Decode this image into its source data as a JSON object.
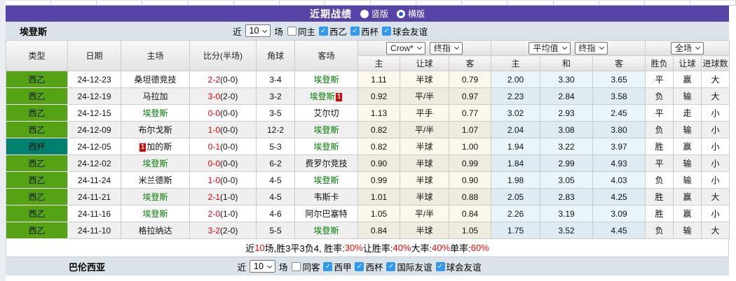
{
  "colors": {
    "accent_purple": "#5843a6",
    "league_green": "#55a315",
    "cup_teal": "#00806e",
    "focal_team_green": "#008000",
    "score_red": "#e00000",
    "result_blue": "#0000cd",
    "checkbox_blue": "#2f99f1"
  },
  "title_bar": {
    "title": "近期战绩",
    "radios": [
      {
        "label": "竖版",
        "selected": false
      },
      {
        "label": "横版",
        "selected": true
      }
    ]
  },
  "team_filter": {
    "team": "埃登斯",
    "near_label": "近",
    "count_select": "10",
    "unit_label": "场",
    "checkboxes": [
      {
        "label": "同主",
        "checked": false
      },
      {
        "label": "西乙",
        "checked": true
      },
      {
        "label": "西杯",
        "checked": true
      },
      {
        "label": "球会友谊",
        "checked": true
      }
    ]
  },
  "table": {
    "dropdowns": {
      "odds_source": "Crow*",
      "odds_stage": "终指",
      "avg_source": "平均值",
      "avg_stage": "终指",
      "scope": "全场"
    },
    "columns": {
      "type": "类型",
      "date": "日期",
      "home": "主场",
      "score": "比分(半场)",
      "corner": "角球",
      "away": "客场",
      "odds_home": "主",
      "odds_handicap": "让球",
      "odds_away": "客",
      "avg_home": "主",
      "avg_draw": "和",
      "avg_away": "客",
      "result_wdl": "胜负",
      "result_handicap": "让球",
      "result_goals": "进球数"
    },
    "rows": [
      {
        "type": "西乙",
        "type_color": "green",
        "date": "24-12-23",
        "home": {
          "name": "桑坦德竞技",
          "focal": false,
          "badge": "",
          "badge_side": ""
        },
        "score": "2-2",
        "half": "(0-0)",
        "corner": "3-4",
        "away": {
          "name": "埃登斯",
          "focal": true,
          "badge": "",
          "badge_side": ""
        },
        "odds": [
          "1.11",
          "半球",
          "0.79"
        ],
        "avg": [
          "2.00",
          "3.30",
          "3.65"
        ],
        "results": [
          "平",
          "赢",
          "大"
        ]
      },
      {
        "type": "西乙",
        "type_color": "green",
        "date": "24-12-19",
        "home": {
          "name": "马拉加",
          "focal": false,
          "badge": "",
          "badge_side": ""
        },
        "score": "3-0",
        "half": "(2-0)",
        "corner": "3-2",
        "away": {
          "name": "埃登斯",
          "focal": true,
          "badge": "1",
          "badge_side": "after"
        },
        "odds": [
          "0.92",
          "平/半",
          "0.97"
        ],
        "avg": [
          "2.23",
          "2.84",
          "3.58"
        ],
        "results": [
          "负",
          "输",
          "大"
        ]
      },
      {
        "type": "西乙",
        "type_color": "green",
        "date": "24-12-15",
        "home": {
          "name": "埃登斯",
          "focal": true,
          "badge": "",
          "badge_side": ""
        },
        "score": "0-0",
        "half": "(0-0)",
        "corner": "3-5",
        "away": {
          "name": "艾尔切",
          "focal": false,
          "badge": "",
          "badge_side": ""
        },
        "odds": [
          "1.13",
          "平手",
          "0.77"
        ],
        "avg": [
          "3.02",
          "2.93",
          "2.45"
        ],
        "results": [
          "平",
          "走",
          "小"
        ]
      },
      {
        "type": "西乙",
        "type_color": "green",
        "date": "24-12-09",
        "home": {
          "name": "布尔戈斯",
          "focal": false,
          "badge": "",
          "badge_side": ""
        },
        "score": "1-0",
        "half": "(0-0)",
        "corner": "12-2",
        "away": {
          "name": "埃登斯",
          "focal": true,
          "badge": "",
          "badge_side": ""
        },
        "odds": [
          "0.82",
          "平/半",
          "1.07"
        ],
        "avg": [
          "2.04",
          "3.08",
          "3.80"
        ],
        "results": [
          "负",
          "输",
          "小"
        ]
      },
      {
        "type": "西杯",
        "type_color": "teal",
        "date": "24-12-05",
        "home": {
          "name": "加的斯",
          "focal": false,
          "badge": "1",
          "badge_side": "before"
        },
        "score": "0-1",
        "half": "(0-0)",
        "corner": "5-3",
        "away": {
          "name": "埃登斯",
          "focal": true,
          "badge": "",
          "badge_side": ""
        },
        "odds": [
          "0.82",
          "半球",
          "1.00"
        ],
        "avg": [
          "1.94",
          "3.22",
          "3.97"
        ],
        "results": [
          "胜",
          "赢",
          "小"
        ]
      },
      {
        "type": "西乙",
        "type_color": "green",
        "date": "24-12-02",
        "home": {
          "name": "埃登斯",
          "focal": true,
          "badge": "",
          "badge_side": ""
        },
        "score": "0-0",
        "half": "(0-0)",
        "corner": "6-2",
        "away": {
          "name": "费罗尔竞技",
          "focal": false,
          "badge": "",
          "badge_side": ""
        },
        "odds": [
          "0.90",
          "半球",
          "0.99"
        ],
        "avg": [
          "1.84",
          "2.99",
          "4.93"
        ],
        "results": [
          "平",
          "输",
          "小"
        ]
      },
      {
        "type": "西乙",
        "type_color": "green",
        "date": "24-11-24",
        "home": {
          "name": "米兰德斯",
          "focal": false,
          "badge": "",
          "badge_side": ""
        },
        "score": "1-0",
        "half": "(0-0)",
        "corner": "4-5",
        "away": {
          "name": "埃登斯",
          "focal": true,
          "badge": "",
          "badge_side": ""
        },
        "odds": [
          "0.99",
          "半球",
          "0.90"
        ],
        "avg": [
          "1.98",
          "3.05",
          "4.03"
        ],
        "results": [
          "负",
          "输",
          "小"
        ]
      },
      {
        "type": "西乙",
        "type_color": "green",
        "date": "24-11-21",
        "home": {
          "name": "埃登斯",
          "focal": true,
          "badge": "",
          "badge_side": ""
        },
        "score": "2-1",
        "half": "(1-0)",
        "corner": "4-5",
        "away": {
          "name": "韦斯卡",
          "focal": false,
          "badge": "",
          "badge_side": ""
        },
        "odds": [
          "1.01",
          "半球",
          "0.88"
        ],
        "avg": [
          "2.05",
          "2.83",
          "4.25"
        ],
        "results": [
          "胜",
          "赢",
          "大"
        ]
      },
      {
        "type": "西乙",
        "type_color": "green",
        "date": "24-11-16",
        "home": {
          "name": "埃登斯",
          "focal": true,
          "badge": "",
          "badge_side": ""
        },
        "score": "2-0",
        "half": "(1-0)",
        "corner": "4-6",
        "away": {
          "name": "阿尔巴塞特",
          "focal": false,
          "badge": "",
          "badge_side": ""
        },
        "odds": [
          "1.05",
          "平/半",
          "0.84"
        ],
        "avg": [
          "2.26",
          "3.19",
          "3.09"
        ],
        "results": [
          "胜",
          "赢",
          "小"
        ]
      },
      {
        "type": "西乙",
        "type_color": "green",
        "date": "24-11-10",
        "home": {
          "name": "格拉纳达",
          "focal": false,
          "badge": "",
          "badge_side": ""
        },
        "score": "3-2",
        "half": "(2-0)",
        "corner": "5-5",
        "away": {
          "name": "埃登斯",
          "focal": true,
          "badge": "",
          "badge_side": ""
        },
        "odds": [
          "0.84",
          "半球",
          "1.05"
        ],
        "avg": [
          "1.75",
          "3.52",
          "4.45"
        ],
        "results": [
          "负",
          "输",
          "大"
        ]
      }
    ]
  },
  "summary": {
    "parts": [
      {
        "t": "近",
        "c": "k"
      },
      {
        "t": "10",
        "c": "r"
      },
      {
        "t": "场,胜3平3负4, 胜率:",
        "c": "k"
      },
      {
        "t": "30%",
        "c": "r"
      },
      {
        "t": " 让胜率:",
        "c": "k"
      },
      {
        "t": "40%",
        "c": "r"
      },
      {
        "t": " 大率:",
        "c": "k"
      },
      {
        "t": "40%",
        "c": "r"
      },
      {
        "t": " 单率:",
        "c": "k"
      },
      {
        "t": "60%",
        "c": "r"
      }
    ]
  },
  "next_team_filter": {
    "team": "巴伦西亚",
    "near_label": "近",
    "count_select": "10",
    "unit_label": "场",
    "checkboxes": [
      {
        "label": "同客",
        "checked": false
      },
      {
        "label": "西甲",
        "checked": true
      },
      {
        "label": "西杯",
        "checked": true
      },
      {
        "label": "国际友谊",
        "checked": true
      },
      {
        "label": "球会友谊",
        "checked": true
      }
    ]
  }
}
